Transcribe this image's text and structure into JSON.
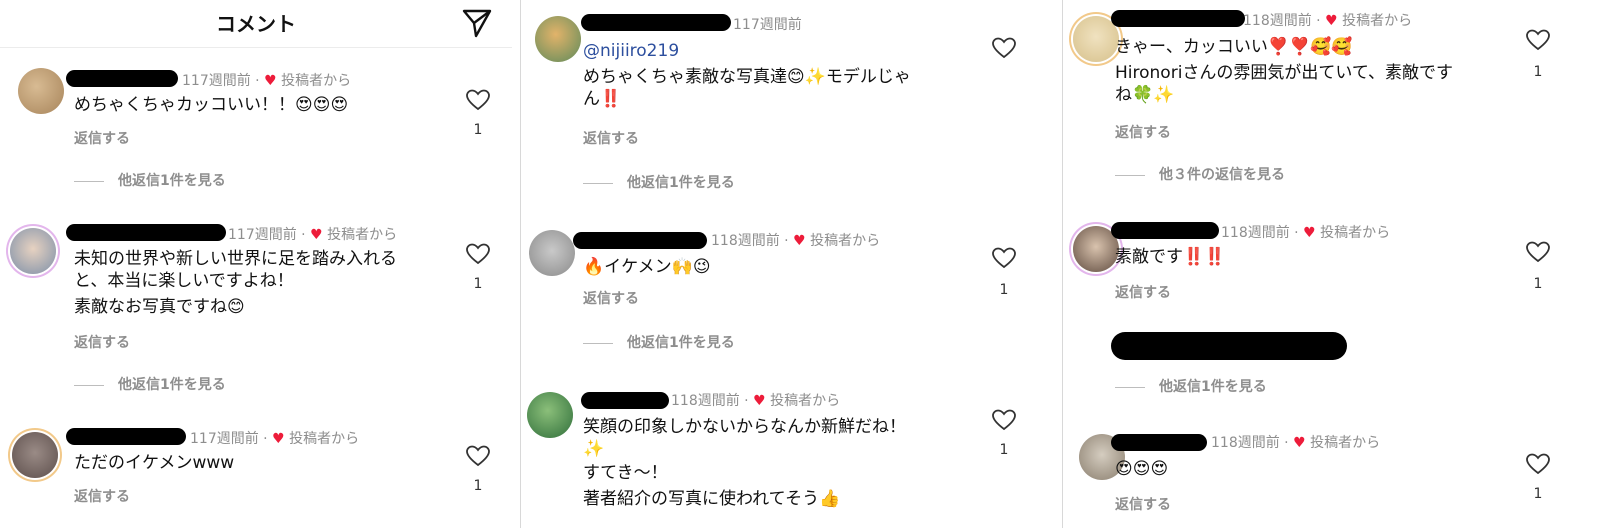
{
  "header": {
    "title": "コメント",
    "share_icon": "paper-plane-icon"
  },
  "colors": {
    "heart": "#ed1c3a",
    "meta_text": "#8e8e8e",
    "mention": "#2d4f9e",
    "redaction": "#000000"
  },
  "labels": {
    "reply": "返信する",
    "from_poster": "投稿者から"
  },
  "panel1": [
    {
      "time": "117週間前",
      "from_poster": true,
      "lines": [
        "めちゃくちゃカッコいい！！😍😍😍"
      ],
      "more": "他返信1件を見る",
      "likes": "1"
    },
    {
      "time": "117週間前",
      "from_poster": true,
      "lines": [
        "未知の世界や新しい世界に足を踏み入れる",
        "と、本当に楽しいですよね！",
        "素敵なお写真ですね😊"
      ],
      "more": "他返信1件を見る",
      "likes": "1"
    },
    {
      "time": "117週間前",
      "from_poster": true,
      "lines": [
        "ただのイケメンwww"
      ],
      "more": "",
      "likes": "1"
    }
  ],
  "panel2": [
    {
      "time": "117週間前",
      "from_poster": false,
      "mention": "@nijiiro219",
      "lines": [
        "めちゃくちゃ素敵な写真達😊✨モデルじゃ",
        "ん‼️"
      ],
      "more": "他返信1件を見る",
      "likes": ""
    },
    {
      "time": "118週間前",
      "from_poster": true,
      "lines": [
        "🔥イケメン🙌😉"
      ],
      "more": "他返信1件を見る",
      "likes": "1"
    },
    {
      "time": "118週間前",
      "from_poster": true,
      "lines": [
        "笑顔の印象しかないからなんか新鮮だね！",
        "✨",
        "すてき〜！",
        "著者紹介の写真に使われてそう👍"
      ],
      "more": "",
      "likes": "1"
    }
  ],
  "panel3": [
    {
      "time": "118週間前",
      "from_poster": true,
      "lines": [
        "きゃー、カッコいい❣️❣️🥰🥰",
        "Hironoriさんの雰囲気が出ていて、素敵です",
        "ね🍀✨"
      ],
      "more": "他３件の返信を見る",
      "likes": "1"
    },
    {
      "time": "118週間前",
      "from_poster": true,
      "lines": [
        "素敵です‼️‼️"
      ],
      "more": "",
      "likes": "1"
    },
    {
      "time": "",
      "from_poster": false,
      "lines": [],
      "more": "他返信1件を見る",
      "likes": ""
    },
    {
      "time": "118週間前",
      "from_poster": true,
      "lines": [
        "😍😍😍"
      ],
      "more": "",
      "likes": "1"
    }
  ]
}
